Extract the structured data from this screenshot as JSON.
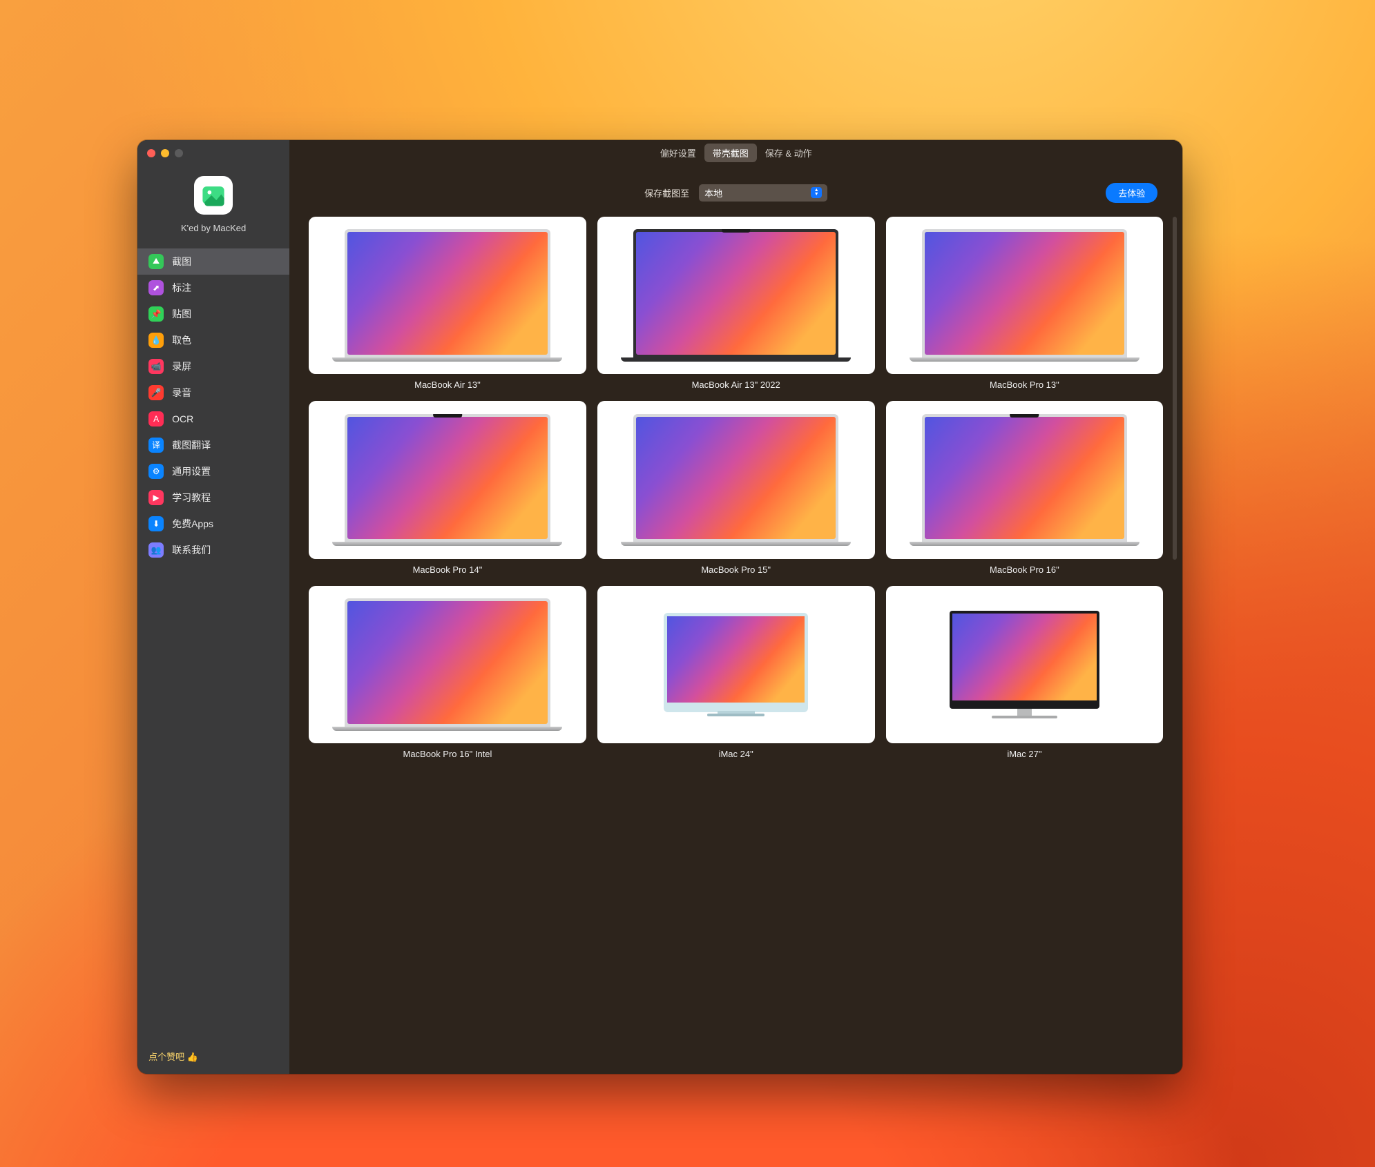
{
  "sidebar": {
    "app_title": "K'ed by MacKed",
    "items": [
      {
        "label": "截图",
        "color": "#34c759",
        "glyph": "⛰"
      },
      {
        "label": "标注",
        "color": "#af52de",
        "glyph": "⬈"
      },
      {
        "label": "贴图",
        "color": "#30d158",
        "glyph": "📌"
      },
      {
        "label": "取色",
        "color": "#ff9f0a",
        "glyph": "💧"
      },
      {
        "label": "录屏",
        "color": "#ff375f",
        "glyph": "📹"
      },
      {
        "label": "录音",
        "color": "#ff3b30",
        "glyph": "🎤"
      },
      {
        "label": "OCR",
        "color": "#ff2d55",
        "glyph": "A"
      },
      {
        "label": "截图翻译",
        "color": "#0a84ff",
        "glyph": "译"
      },
      {
        "label": "通用设置",
        "color": "#0a84ff",
        "glyph": "⚙"
      },
      {
        "label": "学习教程",
        "color": "#ff375f",
        "glyph": "▶"
      },
      {
        "label": "免费Apps",
        "color": "#0a84ff",
        "glyph": "⬇"
      },
      {
        "label": "联系我们",
        "color": "#7d7dff",
        "glyph": "👥"
      }
    ],
    "active_index": 0,
    "footer_text": "点个赞吧 👍"
  },
  "tabs": {
    "items": [
      "偏好设置",
      "带壳截图",
      "保存 & 动作"
    ],
    "active_index": 1
  },
  "save_row": {
    "label": "保存截图至",
    "select_value": "本地",
    "cta": "去体验"
  },
  "devices": [
    {
      "label": "MacBook Air 13\"",
      "kind": "laptop-silver"
    },
    {
      "label": "MacBook Air 13\" 2022",
      "kind": "laptop-dark-notch"
    },
    {
      "label": "MacBook Pro 13\"",
      "kind": "laptop-silver"
    },
    {
      "label": "MacBook Pro 14\"",
      "kind": "laptop-silver-notch"
    },
    {
      "label": "MacBook Pro 15\"",
      "kind": "laptop-silver"
    },
    {
      "label": "MacBook Pro 16\"",
      "kind": "laptop-silver-notch"
    },
    {
      "label": "MacBook Pro 16\" Intel",
      "kind": "laptop-silver"
    },
    {
      "label": "iMac 24\"",
      "kind": "imac24"
    },
    {
      "label": "iMac 27\"",
      "kind": "imac27"
    }
  ]
}
